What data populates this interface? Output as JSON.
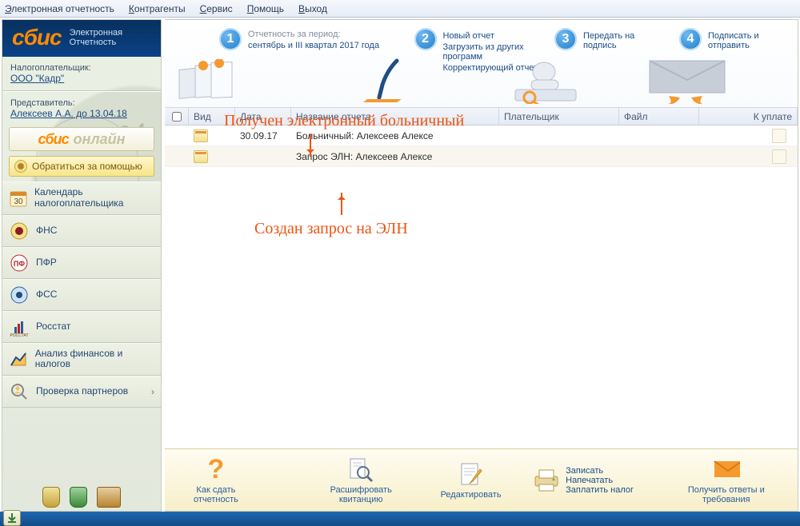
{
  "menu": {
    "items": [
      "Электронная отчетность",
      "Контрагенты",
      "Сервис",
      "Помощь",
      "Выход"
    ],
    "hotkeys": [
      "Э",
      "К",
      "С",
      "П",
      "В"
    ]
  },
  "logo": {
    "brand": "сбис",
    "sub1": "Электронная",
    "sub2": "Отчетность"
  },
  "taxpayer": {
    "label": "Налогоплательщик:",
    "name": "ООО \"Кадр\""
  },
  "rep": {
    "label": "Представитель:",
    "name": "Алексеев А.А. до 13.04.18"
  },
  "sbis_online": {
    "brand": "сбис",
    "word": "онлайн"
  },
  "help_button": "Обратиться за помощью",
  "nav": [
    {
      "icon": "calendar",
      "text": "Календарь налогоплательщика"
    },
    {
      "icon": "fns",
      "text": "ФНС"
    },
    {
      "icon": "pfr",
      "text": "ПФР"
    },
    {
      "icon": "fss",
      "text": "ФСС"
    },
    {
      "icon": "rosstat",
      "text": "Росстат"
    },
    {
      "icon": "chart",
      "text": "Анализ финансов и налогов"
    },
    {
      "icon": "search",
      "text": "Проверка партнеров",
      "chevron": true
    }
  ],
  "steps": {
    "s1": {
      "num": "1",
      "gray": "Отчетность за период:",
      "link": "сентябрь и III квартал 2017 года"
    },
    "s2": {
      "num": "2",
      "a": "Новый отчет",
      "b": "Загрузить из других программ",
      "c": "Корректирующий отчет"
    },
    "s3": {
      "num": "3",
      "a": "Передать на подпись"
    },
    "s4": {
      "num": "4",
      "a": "Подписать и отправить"
    }
  },
  "columns": {
    "vid": "Вид",
    "date": "Дата",
    "name": "Название отчета",
    "payer": "Плательщик",
    "file": "Файл",
    "pay": "К уплате"
  },
  "rows": [
    {
      "date": "30.09.17",
      "name": "Больничный: Алексеев Алексе"
    },
    {
      "date": "",
      "name": "Запрос ЭЛН: Алексеев Алексе"
    }
  ],
  "annotations": {
    "top": "Получен электронный больничный",
    "bottom": "Создан запрос на ЭЛН"
  },
  "toolbar": {
    "howto": "Как сдать отчетность",
    "decrypt": "Расшифровать квитанцию",
    "edit": "Редактировать",
    "list": {
      "a": "Записать",
      "b": "Напечатать",
      "c": "Заплатить налог"
    },
    "answers": "Получить ответы и требования"
  }
}
